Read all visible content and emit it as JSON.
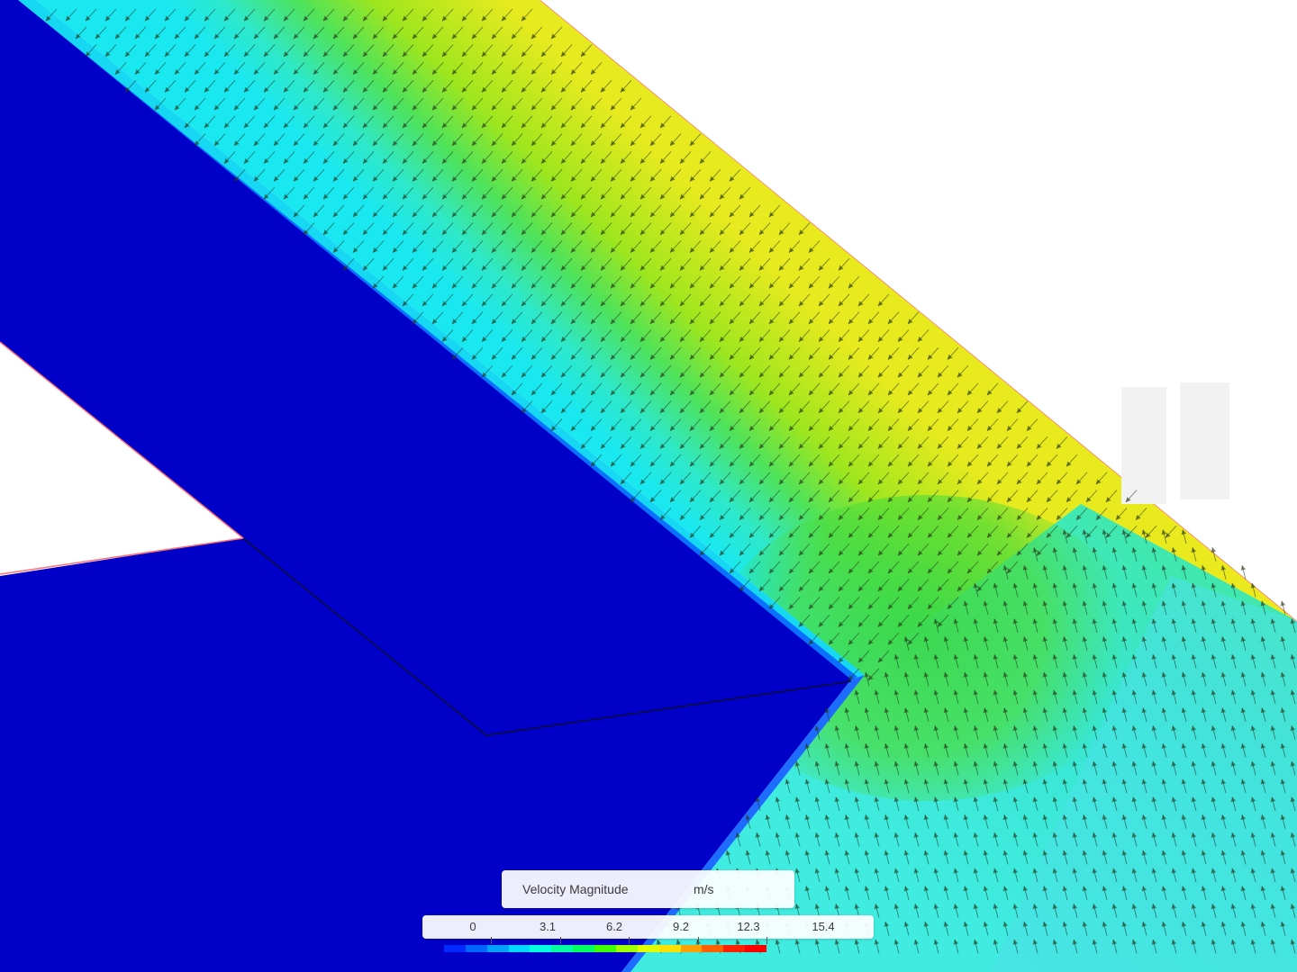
{
  "legend": {
    "title": "Velocity Magnitude",
    "unit": "m/s",
    "ticks": [
      "0",
      "3.1",
      "6.2",
      "9.2",
      "12.3",
      "15.4"
    ],
    "colormap": [
      "#0000c8",
      "#0028ff",
      "#0064ff",
      "#00a0ff",
      "#00d8ff",
      "#00ffe0",
      "#00ffa0",
      "#00ff60",
      "#40ff00",
      "#a0ff00",
      "#e0ff00",
      "#ffe000",
      "#ffa000",
      "#ff6000",
      "#ff2000",
      "#ff0000"
    ]
  },
  "colors": {
    "solid_region": "#0000c8",
    "high_velocity": "#f0ea1e",
    "mid_velocity": "#5ee61e",
    "low_velocity": "#37ead8",
    "boundary_line": "#ff7070"
  },
  "watermark": {
    "color": "#f2f2f2"
  }
}
